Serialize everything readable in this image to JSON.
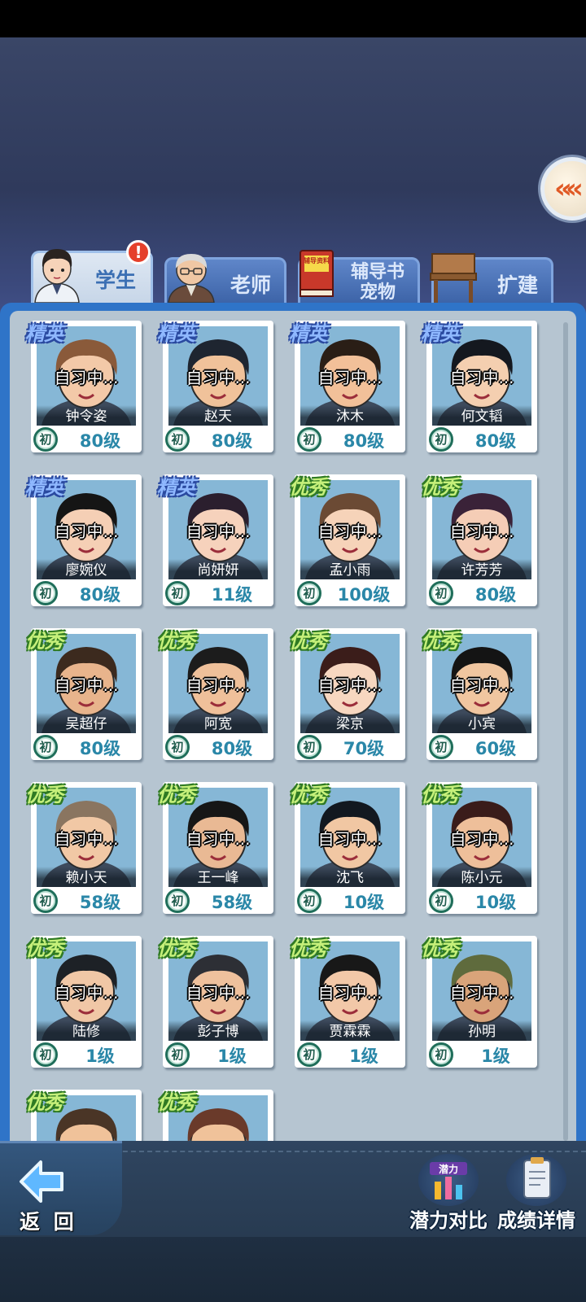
{
  "tabs": [
    {
      "label": "学生",
      "active": true,
      "badge": "!"
    },
    {
      "label": "老师",
      "active": false
    },
    {
      "label": "辅导书\n宠物",
      "line1": "辅导书",
      "line2": "宠物",
      "book_text": "辅导资料",
      "active": false
    },
    {
      "label": "扩建",
      "active": false
    }
  ],
  "side_toggle": {
    "icon": "double-chevron-left-icon"
  },
  "students": [
    {
      "rank": "精英",
      "rank_type": "elite",
      "status": "自习中...",
      "name": "钟令姿",
      "grade": "初",
      "level": "80级",
      "hair": "#8a5a3a",
      "skin": "#f3c9a8"
    },
    {
      "rank": "精英",
      "rank_type": "elite",
      "status": "自习中...",
      "name": "赵天",
      "grade": "初",
      "level": "80级",
      "hair": "#1e2530",
      "skin": "#f0c29a"
    },
    {
      "rank": "精英",
      "rank_type": "elite",
      "status": "自习中...",
      "name": "沐木",
      "grade": "初",
      "level": "80级",
      "hair": "#2a1e16",
      "skin": "#f2c099"
    },
    {
      "rank": "精英",
      "rank_type": "elite",
      "status": "自习中...",
      "name": "何文韬",
      "grade": "初",
      "level": "80级",
      "hair": "#14181f",
      "skin": "#f4cfb0"
    },
    {
      "rank": "精英",
      "rank_type": "elite",
      "status": "自习中...",
      "name": "廖婉仪",
      "grade": "初",
      "level": "80级",
      "hair": "#151515",
      "skin": "#f5cfb5"
    },
    {
      "rank": "精英",
      "rank_type": "elite",
      "status": "自习中...",
      "name": "尚妍妍",
      "grade": "初",
      "level": "11级",
      "hair": "#2b1f2e",
      "skin": "#f6d2bc"
    },
    {
      "rank": "优秀",
      "rank_type": "good",
      "status": "自习中...",
      "name": "孟小雨",
      "grade": "初",
      "level": "100级",
      "hair": "#6b4a34",
      "skin": "#f6d3b9"
    },
    {
      "rank": "优秀",
      "rank_type": "good",
      "status": "自习中...",
      "name": "许芳芳",
      "grade": "初",
      "level": "80级",
      "hair": "#3a2238",
      "skin": "#f5cdb6"
    },
    {
      "rank": "优秀",
      "rank_type": "good",
      "status": "自习中...",
      "name": "吴超仔",
      "grade": "初",
      "level": "80级",
      "hair": "#3c2a1e",
      "skin": "#e8b48c"
    },
    {
      "rank": "优秀",
      "rank_type": "good",
      "status": "自习中...",
      "name": "阿宽",
      "grade": "初",
      "level": "80级",
      "hair": "#1c1c1c",
      "skin": "#efc09a"
    },
    {
      "rank": "优秀",
      "rank_type": "good",
      "status": "自习中...",
      "name": "梁京",
      "grade": "初",
      "level": "70级",
      "hair": "#3b1d1a",
      "skin": "#f7d7c0"
    },
    {
      "rank": "优秀",
      "rank_type": "good",
      "status": "自习中...",
      "name": "小宾",
      "grade": "初",
      "level": "60级",
      "hair": "#141414",
      "skin": "#f0c6a0"
    },
    {
      "rank": "优秀",
      "rank_type": "good",
      "status": "自习中...",
      "name": "赖小天",
      "grade": "初",
      "level": "58级",
      "hair": "#8a7560",
      "skin": "#f1c8a5"
    },
    {
      "rank": "优秀",
      "rank_type": "good",
      "status": "自习中...",
      "name": "王一峰",
      "grade": "初",
      "level": "58级",
      "hair": "#161616",
      "skin": "#e9b994"
    },
    {
      "rank": "优秀",
      "rank_type": "good",
      "status": "自习中...",
      "name": "沈飞",
      "grade": "初",
      "level": "10级",
      "hair": "#121820",
      "skin": "#f1c7a3"
    },
    {
      "rank": "优秀",
      "rank_type": "good",
      "status": "自习中...",
      "name": "陈小元",
      "grade": "初",
      "level": "10级",
      "hair": "#3a1c1a",
      "skin": "#eebf9a"
    },
    {
      "rank": "优秀",
      "rank_type": "good",
      "status": "自习中...",
      "name": "陆修",
      "grade": "初",
      "level": "1级",
      "hair": "#1d2126",
      "skin": "#f0c7a6"
    },
    {
      "rank": "优秀",
      "rank_type": "good",
      "status": "自习中...",
      "name": "彭子博",
      "grade": "初",
      "level": "1级",
      "hair": "#2d2f35",
      "skin": "#efc19d"
    },
    {
      "rank": "优秀",
      "rank_type": "good",
      "status": "自习中...",
      "name": "贾霖霖",
      "grade": "初",
      "level": "1级",
      "hair": "#181818",
      "skin": "#f2c8a8"
    },
    {
      "rank": "优秀",
      "rank_type": "good",
      "status": "自习中...",
      "name": "孙明",
      "grade": "初",
      "level": "1级",
      "hair": "#5f6b3d",
      "skin": "#d9a47a"
    },
    {
      "rank": "优秀",
      "rank_type": "good",
      "status": "",
      "name": "",
      "grade": "",
      "level": "",
      "hair": "#4a3526",
      "skin": "#f0c29a"
    },
    {
      "rank": "优秀",
      "rank_type": "good",
      "status": "",
      "name": "",
      "grade": "",
      "level": "",
      "hair": "#6a3a2a",
      "skin": "#f0c29a"
    }
  ],
  "bottom": {
    "back_label": "返 回",
    "compare": {
      "label": "潜力对比",
      "icon": "potential-chart-icon",
      "icon_text": "潜力"
    },
    "details": {
      "label": "成绩详情",
      "icon": "report-clipboard-icon"
    }
  },
  "colors": {
    "panel_border": "#2f74c8",
    "panel_fill": "#b6c5d1",
    "level_text": "#2a87a8"
  }
}
